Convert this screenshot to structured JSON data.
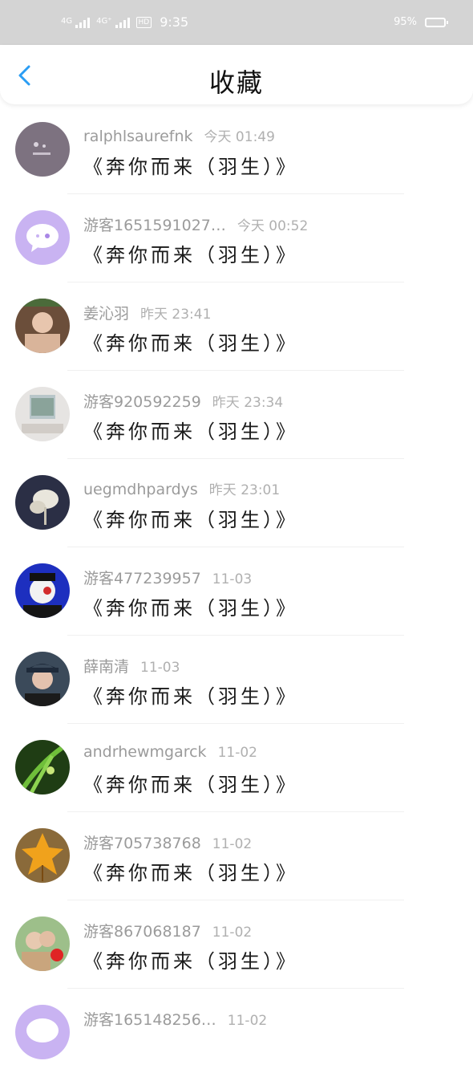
{
  "status_bar": {
    "network1": "4G",
    "network2": "4G⁺",
    "hd": "HD",
    "time": "9:35",
    "battery": "95%"
  },
  "nav": {
    "title": "收藏"
  },
  "items": [
    {
      "user": "ralphlsaurefnk",
      "time": "今天 01:49",
      "title": "《奔你而来（羽生）》"
    },
    {
      "user": "游客1651591027…",
      "time": "今天 00:52",
      "title": "《奔你而来（羽生）》"
    },
    {
      "user": "姜沁羽",
      "time": "昨天 23:41",
      "title": "《奔你而来（羽生）》"
    },
    {
      "user": "游客920592259",
      "time": "昨天 23:34",
      "title": "《奔你而来（羽生）》"
    },
    {
      "user": "uegmdhpardys",
      "time": "昨天 23:01",
      "title": "《奔你而来（羽生）》"
    },
    {
      "user": "游客477239957",
      "time": "11-03",
      "title": "《奔你而来（羽生）》"
    },
    {
      "user": "薛南清",
      "time": "11-03",
      "title": "《奔你而来（羽生）》"
    },
    {
      "user": "andrhewmgarck",
      "time": "11-02",
      "title": "《奔你而来（羽生）》"
    },
    {
      "user": "游客705738768",
      "time": "11-02",
      "title": "《奔你而来（羽生）》"
    },
    {
      "user": "游客867068187",
      "time": "11-02",
      "title": "《奔你而来（羽生）》"
    },
    {
      "user": "游客165148256…",
      "time": "11-02",
      "title": ""
    }
  ],
  "colors": {
    "accent": "#2a9df4",
    "status_bar": "#d4d4d4"
  }
}
